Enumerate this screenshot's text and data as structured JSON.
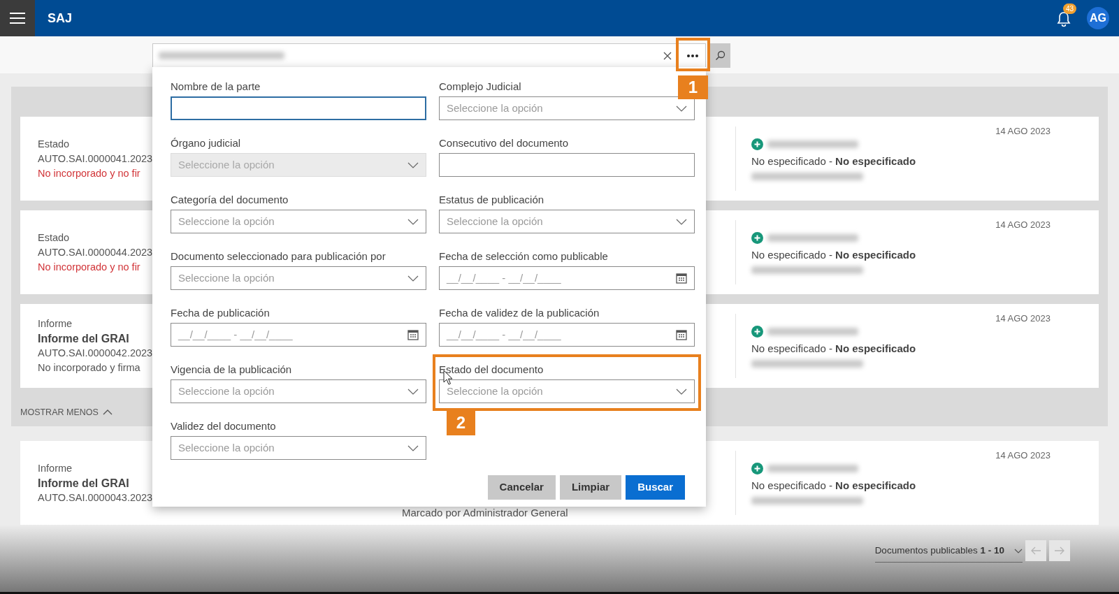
{
  "app_bar": {
    "title": "SAJ",
    "notifications": "43",
    "avatar": "AG"
  },
  "search_bar": {
    "more_callout": "1"
  },
  "filter_panel": {
    "fields": [
      {
        "label": "Nombre de la parte",
        "kind": "text",
        "disabled": false,
        "focused": true
      },
      {
        "label": "Complejo Judicial",
        "kind": "select",
        "placeholder": "Seleccione la opción",
        "disabled": false,
        "focused": false
      },
      {
        "label": "Órgano judicial",
        "kind": "select",
        "placeholder": "Seleccione la opción",
        "disabled": true,
        "focused": false
      },
      {
        "label": "Consecutivo del documento",
        "kind": "text",
        "disabled": false,
        "focused": false
      },
      {
        "label": "Categoría del documento",
        "kind": "select",
        "placeholder": "Seleccione la opción",
        "disabled": false,
        "focused": false
      },
      {
        "label": "Estatus de publicación",
        "kind": "select",
        "placeholder": "Seleccione la opción",
        "disabled": false,
        "focused": false
      },
      {
        "label": "Documento seleccionado para publicación por",
        "kind": "select",
        "placeholder": "Seleccione la opción",
        "disabled": false,
        "focused": false
      },
      {
        "label": "Fecha de selección como publicable",
        "kind": "date",
        "placeholder": "__/__/____ - __/__/____",
        "disabled": false,
        "focused": false
      },
      {
        "label": "Fecha de publicación",
        "kind": "date",
        "placeholder": "__/__/____ - __/__/____",
        "disabled": false,
        "focused": false
      },
      {
        "label": "Fecha de validez de la publicación",
        "kind": "date",
        "placeholder": "__/__/____ - __/__/____",
        "disabled": false,
        "focused": false
      },
      {
        "label": "Vigencia de la publicación",
        "kind": "select",
        "placeholder": "Seleccione la opción",
        "disabled": false,
        "focused": false
      },
      {
        "label": "Estado del documento",
        "kind": "select",
        "placeholder": "Seleccione la opción",
        "disabled": false,
        "focused": false,
        "callout": "2"
      },
      {
        "label": "Validez del documento",
        "kind": "select",
        "placeholder": "Seleccione la opción",
        "disabled": false,
        "focused": false
      }
    ],
    "buttons": [
      {
        "label": "Cancelar",
        "kind": "secondary"
      },
      {
        "label": "Limpiar",
        "kind": "secondary"
      },
      {
        "label": "Buscar",
        "kind": "primary"
      }
    ]
  },
  "expanded_group": {
    "expanded": true,
    "toggle_label": "MOSTRAR MENOS",
    "cards": [
      {
        "type": "Estado",
        "code": "AUTO.SAI.0000041.2023",
        "status": "No incorporado y no fir",
        "alert": true,
        "party": "No especificado - **No especificado**",
        "date": "14 AGO 2023"
      },
      {
        "type": "Estado",
        "code": "AUTO.SAI.0000044.2023",
        "status": "No incorporado y no fir",
        "alert": true,
        "party": "No especificado - **No especificado**",
        "date": "14 AGO 2023"
      },
      {
        "type": "Informe",
        "title": "Informe del GRAI",
        "code": "AUTO.SAI.0000042.2023",
        "status": "No incorporado y firma",
        "alert": false,
        "party": "No especificado - **No especificado**",
        "date": "14 AGO 2023"
      }
    ]
  },
  "cards": [
    {
      "type": "Informe",
      "title": "Informe del GRAI",
      "code": "AUTO.SAI.0000043.2023",
      "note": "Marcado por Administrador General",
      "party": "No especificado - **No especificado**",
      "date": "14 AGO 2023"
    }
  ],
  "pagination": {
    "label": "Documentos publicables",
    "range": "1 - 10"
  }
}
